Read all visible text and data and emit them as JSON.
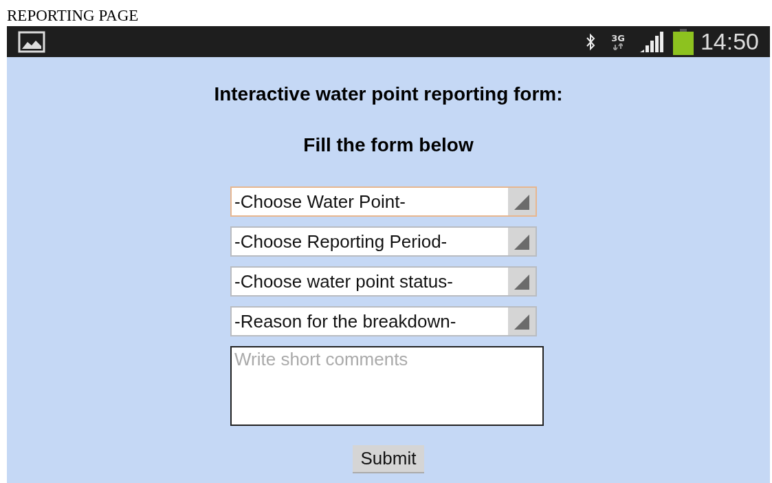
{
  "page_caption": "REPORTING PAGE",
  "status_bar": {
    "network": "3G",
    "time": "14:50"
  },
  "form": {
    "title": "Interactive water point reporting form:",
    "subtitle": "Fill the form below",
    "selects": [
      {
        "value": "-Choose Water Point-",
        "focused": true
      },
      {
        "value": "-Choose Reporting Period-",
        "focused": false
      },
      {
        "value": "-Choose water point status-",
        "focused": false
      },
      {
        "value": "-Reason for the breakdown-",
        "focused": false
      }
    ],
    "comments": {
      "placeholder": "Write short comments"
    },
    "submit": "Submit"
  }
}
